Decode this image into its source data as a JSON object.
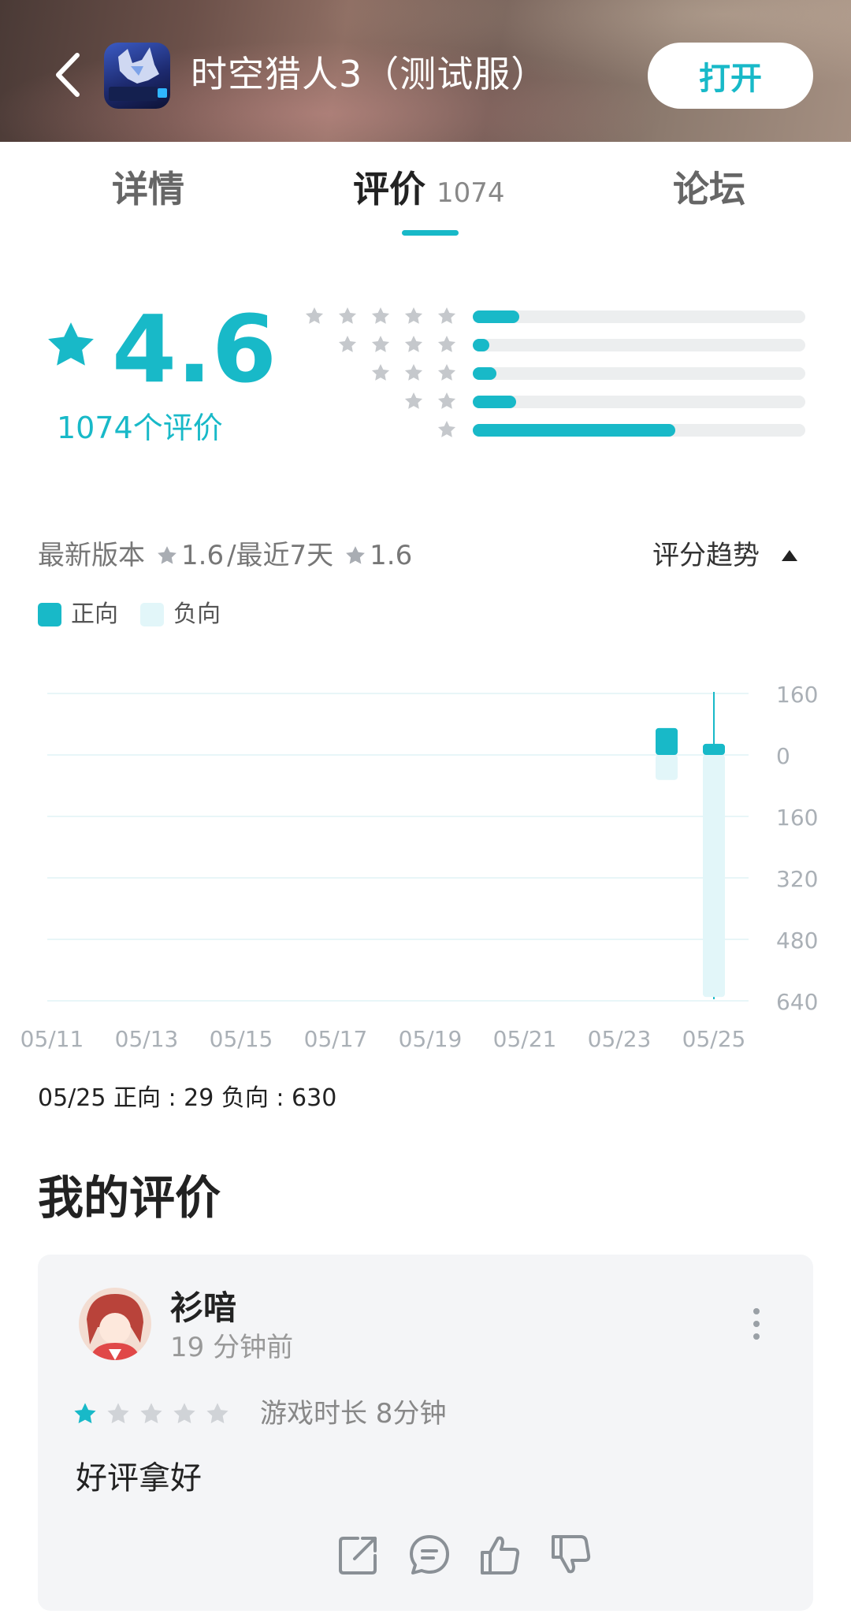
{
  "header": {
    "title": "时空猎人3（测试服）",
    "open_label": "打开",
    "icon_text": "时空猎人3"
  },
  "tabs": [
    {
      "label": "详情",
      "active": false
    },
    {
      "label": "评价",
      "count": "1074",
      "active": true
    },
    {
      "label": "论坛",
      "active": false
    }
  ],
  "rating": {
    "score": "4.6",
    "count_text": "1074个评价",
    "distribution": [
      {
        "stars": 5,
        "fraction": 0.14
      },
      {
        "stars": 4,
        "fraction": 0.05
      },
      {
        "stars": 3,
        "fraction": 0.07
      },
      {
        "stars": 2,
        "fraction": 0.13
      },
      {
        "stars": 1,
        "fraction": 0.61
      }
    ]
  },
  "version": {
    "latest_label": "最新版本",
    "latest_score": "1.6",
    "recent_label": "/最近7天",
    "recent_score": "1.6",
    "trend_label": "评分趋势"
  },
  "legend": {
    "positive": "正向",
    "negative": "负向"
  },
  "colors": {
    "accent": "#18b9c8",
    "negative": "#e2f6f9",
    "star_gray": "#c5c8cc"
  },
  "chart_data": {
    "type": "bar",
    "categories": [
      "05/11",
      "05/12",
      "05/13",
      "05/14",
      "05/15",
      "05/16",
      "05/17",
      "05/18",
      "05/19",
      "05/20",
      "05/21",
      "05/22",
      "05/23",
      "05/24",
      "05/25"
    ],
    "x_tick_labels": [
      "05/11",
      "05/13",
      "05/15",
      "05/17",
      "05/19",
      "05/21",
      "05/23",
      "05/25"
    ],
    "y_tick_labels": [
      "160",
      "0",
      "160",
      "320",
      "480",
      "640"
    ],
    "series": [
      {
        "name": "正向",
        "values": [
          0,
          0,
          0,
          0,
          0,
          0,
          0,
          0,
          0,
          0,
          0,
          0,
          0,
          70,
          29
        ]
      },
      {
        "name": "负向",
        "values": [
          0,
          0,
          0,
          0,
          0,
          0,
          0,
          0,
          0,
          0,
          0,
          0,
          0,
          65,
          630
        ]
      }
    ],
    "ylim": [
      -640,
      160
    ],
    "selected": "05/25"
  },
  "chart_summary": "05/25 正向 : 29  负向 : 630",
  "my_review": {
    "section_title": "我的评价",
    "user_name": "衫喑",
    "time": "19 分钟前",
    "rating": 1,
    "play_time": "游戏时长 8分钟",
    "text": "好评拿好"
  }
}
